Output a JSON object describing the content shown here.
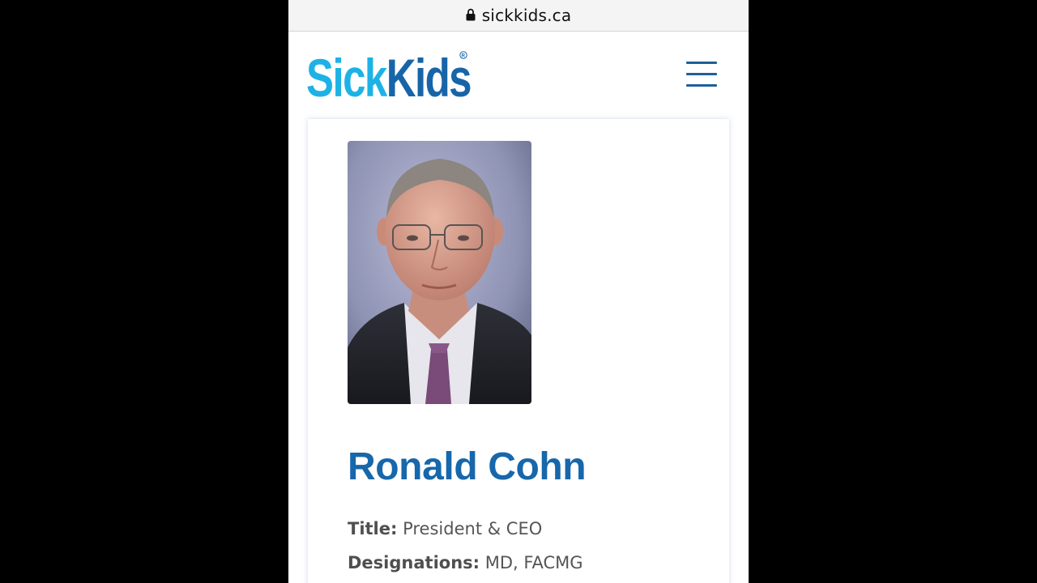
{
  "browser": {
    "url": "sickkids.ca",
    "lock_icon": "lock-icon"
  },
  "header": {
    "logo_text": "SickKids",
    "logo_registered": "®",
    "menu_icon": "hamburger-menu-icon"
  },
  "profile": {
    "photo_alt": "Ronald Cohn",
    "name": "Ronald Cohn",
    "title_label": "Title:",
    "title_value": "President & CEO",
    "designations_label": "Designations:",
    "designations_value": "MD, FACMG"
  },
  "colors": {
    "brand_blue": "#1767ab",
    "logo_cyan": "#1db2e6",
    "logo_navy": "#1765a8",
    "menu_blue": "#1f5f97",
    "page_bg": "#000000"
  }
}
